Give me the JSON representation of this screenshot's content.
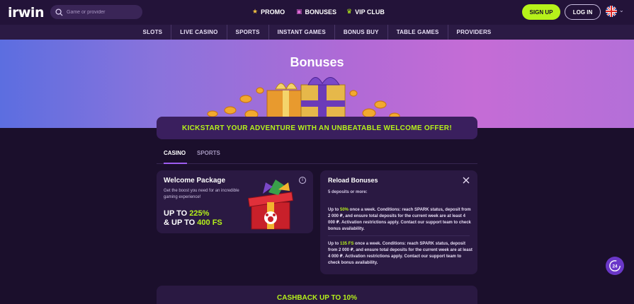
{
  "header": {
    "logo": "irwin",
    "search_placeholder": "Game or provider",
    "nav": [
      {
        "label": "PROMO",
        "icon": "star-icon"
      },
      {
        "label": "BONUSES",
        "icon": "gift-icon"
      },
      {
        "label": "VIP CLUB",
        "icon": "crown-icon"
      }
    ],
    "signup_label": "SIGN UP",
    "login_label": "LOG IN",
    "language_icon": "uk-flag-icon"
  },
  "categories": [
    "SLOTS",
    "LIVE CASINO",
    "SPORTS",
    "INSTANT GAMES",
    "BONUS BUY",
    "TABLE GAMES",
    "PROVIDERS"
  ],
  "hero": {
    "title": "Bonuses"
  },
  "offer_banner": "KICKSTART YOUR ADVENTURE WITH AN UNBEATABLE WELCOME OFFER!",
  "tabs": [
    {
      "label": "CASINO",
      "active": true
    },
    {
      "label": "SPORTS",
      "active": false
    }
  ],
  "welcome": {
    "title": "Welcome Package",
    "description": "Get the boost you need for an incredible gaming experience!",
    "line1_prefix": "UP TO ",
    "line1_value": "225%",
    "line2_prefix": "& UP TO ",
    "line2_value": "400 FS"
  },
  "reload": {
    "title": "Reload Bonuses",
    "subtitle": "5 deposits or more:",
    "p1_prefix": "Up to ",
    "p1_value": "50%",
    "p1_text": " once a week. Conditions: reach SPARK status, deposit from 2 000 ₽, and ensure total deposits for the current week are at least 4 000 ₽. Activation restrictions apply. Contact our support team to check bonus availability.",
    "p2_prefix": "Up to ",
    "p2_value": "135 FS",
    "p2_text": " once a week. Conditions: reach SPARK status, deposit from 2 000 ₽, and ensure total deposits for the current week are at least 4 000 ₽. Activation restrictions apply. Contact our support team to check bonus availability."
  },
  "cashback": "CASHBACK UP TO 10%",
  "support_badge": "24",
  "colors": {
    "accent": "#b6f21a",
    "background": "#1b0f2c",
    "card": "#2a1942",
    "tab_underline": "#9d5cf0"
  }
}
